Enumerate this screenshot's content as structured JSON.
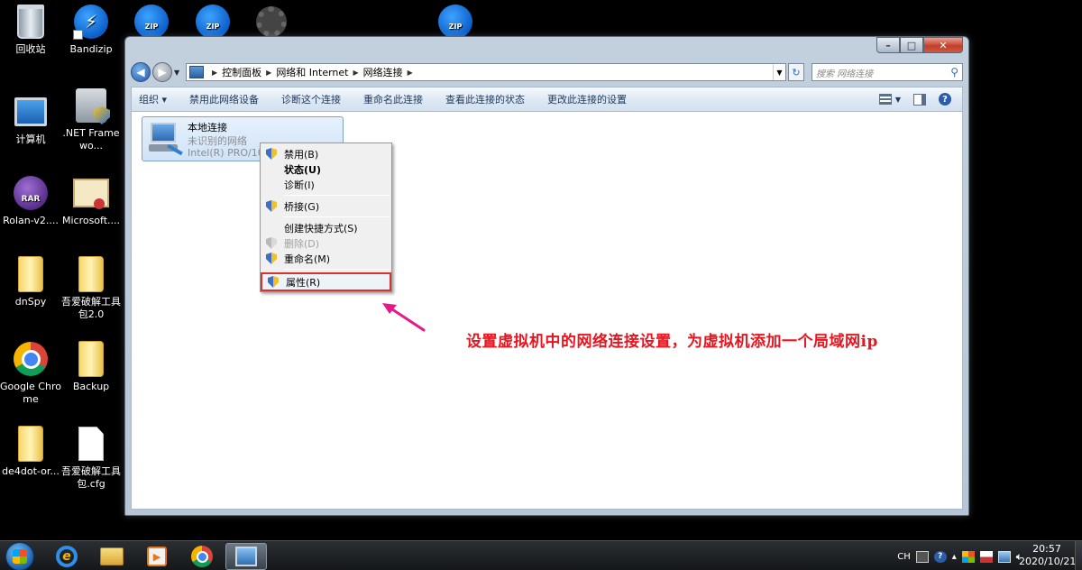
{
  "desktop": {
    "icons": [
      {
        "label": "回收站",
        "icon": "recycle-bin-icon"
      },
      {
        "label": "Bandizip",
        "icon": "bandizip-icon"
      },
      {
        "label": "计算机",
        "icon": "computer-icon"
      },
      {
        "label": ".NET Framewo...",
        "icon": "dotnet-installer-icon"
      },
      {
        "label": "Rolan-v2....",
        "icon": "rar-archive-icon",
        "badge": "RAR"
      },
      {
        "label": "Microsoft....",
        "icon": "certificate-icon"
      },
      {
        "label": "dnSpy",
        "icon": "folder-icon"
      },
      {
        "label": "吾爱破解工具包2.0",
        "icon": "folder-icon"
      },
      {
        "label": "Google Chrome",
        "icon": "chrome-icon"
      },
      {
        "label": "Backup",
        "icon": "folder-icon"
      },
      {
        "label": "de4dot-or...",
        "icon": "folder-icon"
      },
      {
        "label": "吾爱破解工具包.cfg",
        "icon": "file-icon"
      }
    ],
    "partial_icons": [
      {
        "badge": "ZIP",
        "icon": "zip-archive-icon"
      },
      {
        "badge": "ZIP",
        "icon": "zip-archive-icon"
      },
      {
        "badge": "",
        "icon": "gear-file-icon"
      },
      {
        "badge": "ZIP",
        "icon": "zip-archive-icon"
      }
    ]
  },
  "window": {
    "caption": {
      "minimize": "–",
      "maximize": "□",
      "close": "✕"
    },
    "breadcrumbs": [
      "控制面板",
      "网络和 Internet",
      "网络连接"
    ],
    "search_placeholder": "搜索 网络连接",
    "toolbar": {
      "organize": "组织 ▾",
      "disable": "禁用此网络设备",
      "diagnose": "诊断这个连接",
      "rename": "重命名此连接",
      "view_status": "查看此连接的状态",
      "change_settings": "更改此连接的设置"
    },
    "connection": {
      "name": "本地连接",
      "status": "未识别的网络",
      "device": "Intel(R) PRO/10"
    }
  },
  "context_menu": {
    "items": [
      {
        "label": "禁用(B)",
        "icon": "shield-icon"
      },
      {
        "label": "状态(U)",
        "bold": true
      },
      {
        "label": "诊断(I)"
      },
      {
        "label": "桥接(G)",
        "icon": "shield-icon"
      },
      {
        "label": "创建快捷方式(S)"
      },
      {
        "label": "删除(D)",
        "icon": "shield-icon",
        "disabled": true
      },
      {
        "label": "重命名(M)",
        "icon": "shield-icon"
      },
      {
        "label": "属性(R)",
        "icon": "shield-icon",
        "highlighted": true
      }
    ]
  },
  "annotation": {
    "text": "设置虚拟机中的网络连接设置，为虚拟机添加一个局域网ip",
    "color": "#e8141e",
    "arrow_color": "#e6198c"
  },
  "taskbar": {
    "tray_lang": "CH",
    "time": "20:57",
    "date": "2020/10/21"
  }
}
